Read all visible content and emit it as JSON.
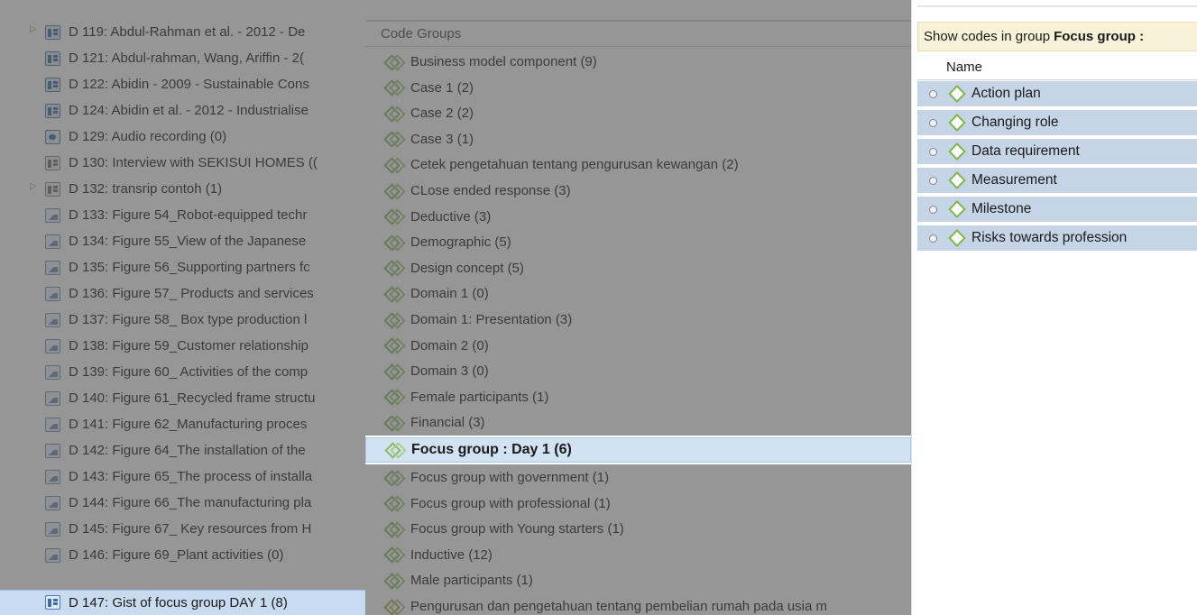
{
  "documents": {
    "items": [
      {
        "label": "D 119: Abdul-Rahman et al. - 2012 - De",
        "icon": "pdf-icon",
        "expandable": true
      },
      {
        "label": "D 121: Abdul-rahman, Wang, Ariffin - 2(",
        "icon": "pdf-icon",
        "expandable": false
      },
      {
        "label": "D 122: Abidin - 2009 - Sustainable Cons",
        "icon": "pdf-icon",
        "expandable": false
      },
      {
        "label": "D 124: Abidin et al. - 2012 - Industrialise",
        "icon": "pdf-icon",
        "expandable": false
      },
      {
        "label": "D 129: Audio recording (0)",
        "icon": "audio-icon",
        "expandable": false
      },
      {
        "label": "D 130: Interview with SEKISUI HOMES ((",
        "icon": "text-doc-icon",
        "expandable": false
      },
      {
        "label": "D 132: transrip contoh (1)",
        "icon": "text-doc-icon",
        "expandable": true
      },
      {
        "label": "D 133: Figure 54_Robot-equipped techr",
        "icon": "image-icon",
        "expandable": false
      },
      {
        "label": "D 134: Figure 55_View of the Japanese",
        "icon": "image-icon",
        "expandable": false
      },
      {
        "label": "D 135: Figure 56_Supporting partners fc",
        "icon": "image-icon",
        "expandable": false
      },
      {
        "label": "D 136: Figure 57_ Products and services",
        "icon": "image-icon",
        "expandable": false
      },
      {
        "label": "D 137: Figure 58_ Box type production l",
        "icon": "image-icon",
        "expandable": false
      },
      {
        "label": "D 138: Figure 59_Customer relationship",
        "icon": "image-icon",
        "expandable": false
      },
      {
        "label": "D 139: Figure 60_ Activities of the comp",
        "icon": "image-icon",
        "expandable": false
      },
      {
        "label": "D 140: Figure 61_Recycled frame structu",
        "icon": "image-icon",
        "expandable": false
      },
      {
        "label": "D 141: Figure 62_Manufacturing proces",
        "icon": "image-icon",
        "expandable": false
      },
      {
        "label": "D 142: Figure 64_The installation of the",
        "icon": "image-icon",
        "expandable": false
      },
      {
        "label": "D 143: Figure 65_The process of installa",
        "icon": "image-icon",
        "expandable": false
      },
      {
        "label": "D 144: Figure 66_The manufacturing pla",
        "icon": "image-icon",
        "expandable": false
      },
      {
        "label": "D 145: Figure 67_ Key resources from H",
        "icon": "image-icon",
        "expandable": false
      },
      {
        "label": "D 146: Figure 69_Plant activities (0)",
        "icon": "image-icon",
        "expandable": false
      }
    ],
    "selected": {
      "label": "D 147: Gist of focus group DAY 1 (8)",
      "icon": "pdf-icon"
    }
  },
  "code_groups": {
    "header": "Code Groups",
    "items": [
      "Business model component (9)",
      "Case 1 (2)",
      "Case 2 (2)",
      "Case 3 (1)",
      "Cetek pengetahuan tentang pengurusan kewangan (2)",
      "CLose ended response (3)",
      "Deductive (3)",
      "Demographic (5)",
      "Design concept (5)",
      "Domain 1 (0)",
      "Domain 1: Presentation (3)",
      "Domain 2 (0)",
      "Domain 3 (0)",
      "Female participants (1)",
      "Financial (3)"
    ],
    "selected": "Focus group : Day 1 (6)",
    "items_after": [
      "Focus group with government (1)",
      "Focus group with professional (1)",
      "Focus group with Young starters (1)",
      "Inductive (12)",
      "Male participants (1)",
      "Pengurusan dan pengetahuan tentang pembelian rumah pada usia m"
    ]
  },
  "codes_panel": {
    "header_prefix": "Show codes in group",
    "header_group": "Focus group :",
    "column_name": "Name",
    "codes": [
      "Action plan",
      "Changing role",
      "Data requirement",
      "Measurement",
      "Milestone",
      "Risks towards profession"
    ]
  },
  "colors": {
    "dim_overlay": "#505050",
    "selection": "#c9dbee",
    "code_row": "#c5d5e7",
    "code_icon": "#7ab648",
    "group_icon": "#8cb86a",
    "filter_bar": "#f7f2d8"
  }
}
